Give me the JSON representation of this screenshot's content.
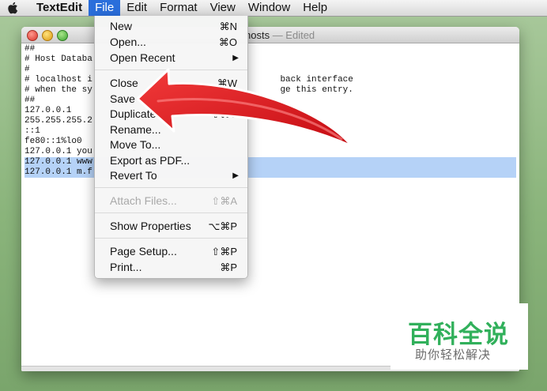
{
  "menubar": {
    "apple_icon": "apple-icon",
    "app_name": "TextEdit",
    "items": [
      {
        "label": "File",
        "active": true
      },
      {
        "label": "Edit"
      },
      {
        "label": "Format"
      },
      {
        "label": "View"
      },
      {
        "label": "Window"
      },
      {
        "label": "Help"
      }
    ]
  },
  "window": {
    "title": "hosts",
    "title_suffix": " — Edited",
    "lines": [
      "##",
      "# Host Databa",
      "#",
      "# localhost i                                    back interface",
      "# when the sy                                    ge this entry.",
      "##",
      "127.0.0.1",
      "255.255.255.2",
      "::1",
      "fe80::1%lo0",
      "127.0.0.1 you",
      "127.0.0.1 www",
      "127.0.0.1 m.f"
    ],
    "selected_lines": [
      11,
      12
    ]
  },
  "file_menu": {
    "items": [
      {
        "label": "New",
        "shortcut": "⌘N"
      },
      {
        "label": "Open...",
        "shortcut": "⌘O"
      },
      {
        "label": "Open Recent",
        "submenu": "▶"
      },
      {
        "label": "Close",
        "shortcut": "⌘W"
      },
      {
        "label": "Save",
        "shortcut": "⌘S"
      },
      {
        "label": "Duplicate",
        "shortcut": "⇧⌘S"
      },
      {
        "label": "Rename..."
      },
      {
        "label": "Move To..."
      },
      {
        "label": "Export as PDF..."
      },
      {
        "label": "Revert To",
        "submenu": "▶"
      },
      {
        "label": "Attach Files...",
        "shortcut": "⇧⌘A",
        "disabled": true
      },
      {
        "label": "Show Properties",
        "shortcut": "⌥⌘P"
      },
      {
        "label": "Page Setup...",
        "shortcut": "⇧⌘P"
      },
      {
        "label": "Print...",
        "shortcut": "⌘P"
      }
    ]
  },
  "annotation": {
    "color": "#e0141b",
    "icon": "red-arrow-pointing-at-save"
  },
  "watermark": {
    "title": "百科全说",
    "subtitle": "助你轻松解决",
    "color": "#31b05b"
  }
}
